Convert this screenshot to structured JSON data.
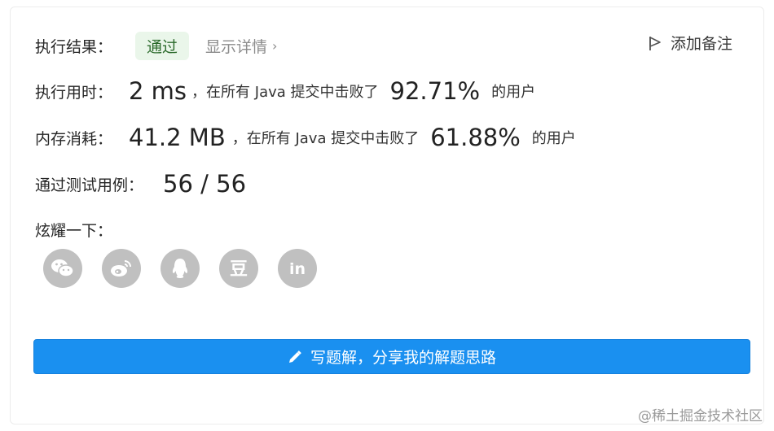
{
  "result": {
    "label": "执行结果：",
    "status": "通过",
    "details_link": "显示详情",
    "details_chevron": "›",
    "add_note": "添加备注"
  },
  "runtime": {
    "label": "执行用时：",
    "value": "2 ms",
    "prefix": "，在所有 Java 提交中击败了",
    "percent": "92.71%",
    "suffix": "的用户"
  },
  "memory": {
    "label": "内存消耗：",
    "value": "41.2 MB",
    "prefix": "，在所有 Java 提交中击败了",
    "percent": "61.88%",
    "suffix": "的用户"
  },
  "tests": {
    "label": "通过测试用例：",
    "value": "56 / 56"
  },
  "share": {
    "label": "炫耀一下：",
    "buttons": [
      {
        "icon": "wechat-icon"
      },
      {
        "icon": "weibo-icon"
      },
      {
        "icon": "qq-icon"
      },
      {
        "icon": "douban-icon",
        "text": "豆"
      },
      {
        "icon": "linkedin-icon",
        "text": "in"
      }
    ]
  },
  "write_button": "写题解，分享我的解题思路",
  "watermark": "@稀土掘金技术社区",
  "colors": {
    "primary": "#1a90f0",
    "success_bg": "#eaf6ea",
    "success_text": "#2b6a2b",
    "share_gray": "#c0c0c0"
  }
}
